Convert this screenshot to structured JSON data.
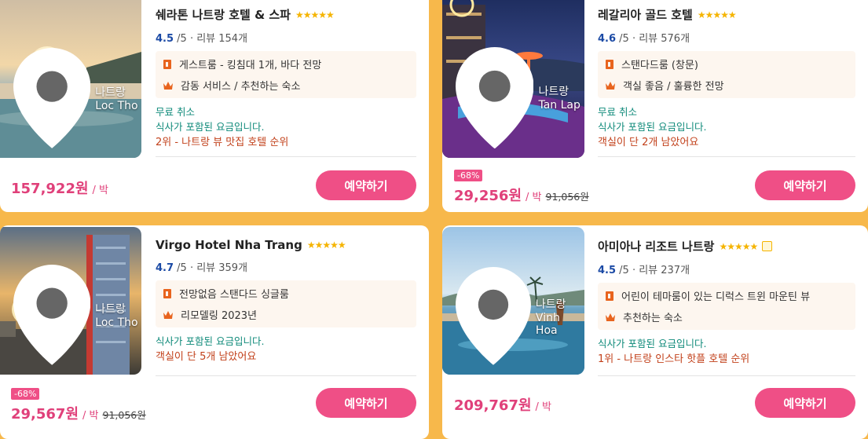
{
  "hotels": [
    {
      "name": "쉐라톤 나트랑 호텔 & 스파",
      "stars": "★★★★★",
      "score": "4.5",
      "score_suffix": " /5 · 리뷰 154개",
      "features": [
        "게스트룸 - 킹침대 1개, 바다 전망",
        "감동 서비스 / 추천하는 숙소"
      ],
      "green_tags": [
        "무료 취소",
        "식사가 포함된 요금입니다."
      ],
      "red_tag": "2위 - 나트랑 뷰 맛집 호텔 순위",
      "location": "나트랑 Loc Tho",
      "discount": "",
      "price": "157,922원",
      "per": "/ 박",
      "original_price": "",
      "book_label": "예약하기"
    },
    {
      "name": "레갈리아 골드 호텔",
      "stars": "★★★★★",
      "score": "4.6",
      "score_suffix": " /5 · 리뷰 576개",
      "features": [
        "스탠다드룸 (창문)",
        "객실 좋음 / 훌륭한 전망"
      ],
      "green_tags": [
        "무료 취소",
        "식사가 포함된 요금입니다."
      ],
      "red_tag": "객실이 단 2개 남았어요",
      "location": "나트랑 Tan Lap",
      "discount": "-68%",
      "price": "29,256원",
      "per": "/ 박",
      "original_price": "91,056원",
      "book_label": "예약하기"
    },
    {
      "name": "Virgo Hotel Nha Trang",
      "stars": "★★★★★",
      "score": "4.7",
      "score_suffix": " /5 · 리뷰 359개",
      "features": [
        "전망없음 스탠다드 싱글룸",
        "리모델링 2023년"
      ],
      "green_tags": [
        "식사가 포함된 요금입니다."
      ],
      "red_tag": "객실이 단 5개 남았어요",
      "location": "나트랑 Loc Tho",
      "discount": "-68%",
      "price": "29,567원",
      "per": "/ 박",
      "original_price": "91,056원",
      "book_label": "예약하기"
    },
    {
      "name": "아미아나 리조트 나트랑",
      "stars": "★★★★★",
      "score": "4.5",
      "score_suffix": " /5 · 리뷰 237개",
      "features": [
        "어린이 테마룸이 있는 디럭스 트윈 마운틴 뷰",
        "추천하는 숙소"
      ],
      "green_tags": [
        "식사가 포함된 요금입니다."
      ],
      "red_tag": "1위 - 나트랑 인스타 핫플 호텔 순위",
      "location": "나트랑 Vinh Hoa",
      "discount": "",
      "price": "209,767원",
      "per": "/ 박",
      "original_price": "",
      "book_label": "예약하기"
    }
  ],
  "colors": {
    "accent": "#ef4f86",
    "price": "#e0407a",
    "star": "#f5b400",
    "score": "#1b4aa5",
    "green": "#0f8a7a",
    "red": "#c2411b",
    "background": "#f7b84b"
  },
  "icons": {
    "feature_room": "door-icon",
    "feature_review": "crown-icon",
    "location": "pin-icon"
  }
}
